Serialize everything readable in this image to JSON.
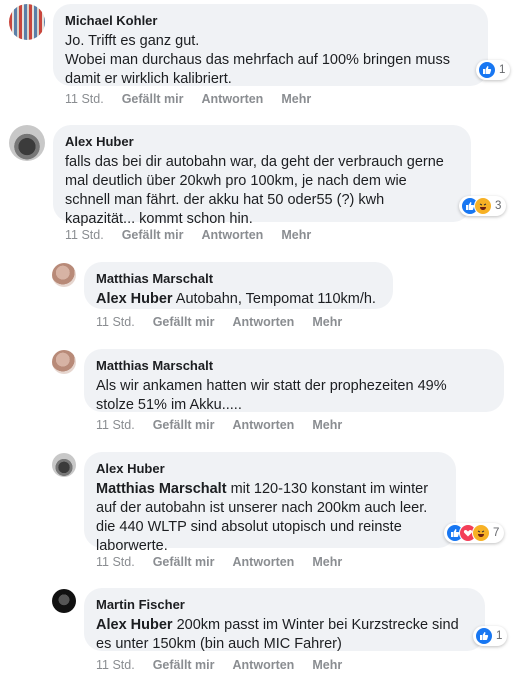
{
  "comments": [
    {
      "author": "Michael Kohler",
      "lines": [
        "Jo. Trifft es ganz gut.",
        "Wobei man durchaus das mehrfach auf 100% bringen muss",
        "damit er wirklich kalibriert."
      ],
      "time": "11 Std.",
      "like": "Gefällt mir",
      "reply": "Antworten",
      "more": "Mehr",
      "reaction_count": "1"
    },
    {
      "author": "Alex Huber",
      "lines": [
        "falls das bei dir autobahn war, da geht der verbrauch gerne",
        "mal deutlich über 20kwh pro 100km, je nach dem wie",
        "schnell man fährt. der akku hat 50 oder55 (?) kwh",
        "kapazität... kommt schon hin."
      ],
      "time": "11 Std.",
      "like": "Gefällt mir",
      "reply": "Antworten",
      "more": "Mehr",
      "reaction_count": "3"
    },
    {
      "author": "Matthias Marschalt",
      "mention": "Alex Huber",
      "text": " Autobahn, Tempomat 110km/h.",
      "time": "11 Std.",
      "like": "Gefällt mir",
      "reply": "Antworten",
      "more": "Mehr"
    },
    {
      "author": "Matthias Marschalt",
      "lines": [
        "Als wir ankamen hatten wir statt der prophezeiten 49%",
        "stolze 51% im Akku....."
      ],
      "time": "11 Std.",
      "like": "Gefällt mir",
      "reply": "Antworten",
      "more": "Mehr"
    },
    {
      "author": "Alex Huber",
      "mention": "Matthias Marschalt",
      "first_line": " mit 120-130 konstant im winter",
      "lines": [
        "auf der autobahn ist unserer nach 200km auch leer.",
        "die 440 WLTP sind absolut utopisch und reinste",
        "laborwerte."
      ],
      "time": "11 Std.",
      "like": "Gefällt mir",
      "reply": "Antworten",
      "more": "Mehr",
      "reaction_count": "7"
    },
    {
      "author": "Martin Fischer",
      "mention": "Alex Huber",
      "first_line": " 200km passt im Winter bei Kurzstrecke sind",
      "lines": [
        "es unter 150km (bin auch MIC Fahrer)"
      ],
      "time": "11 Std.",
      "like": "Gefällt mir",
      "reply": "Antworten",
      "more": "Mehr",
      "reaction_count": "1"
    }
  ],
  "colors": {
    "bubble": "#f0f2f5",
    "meta": "#8a8d91",
    "like": "#1877f2",
    "haha": "#f7b125",
    "love": "#f33e58"
  }
}
